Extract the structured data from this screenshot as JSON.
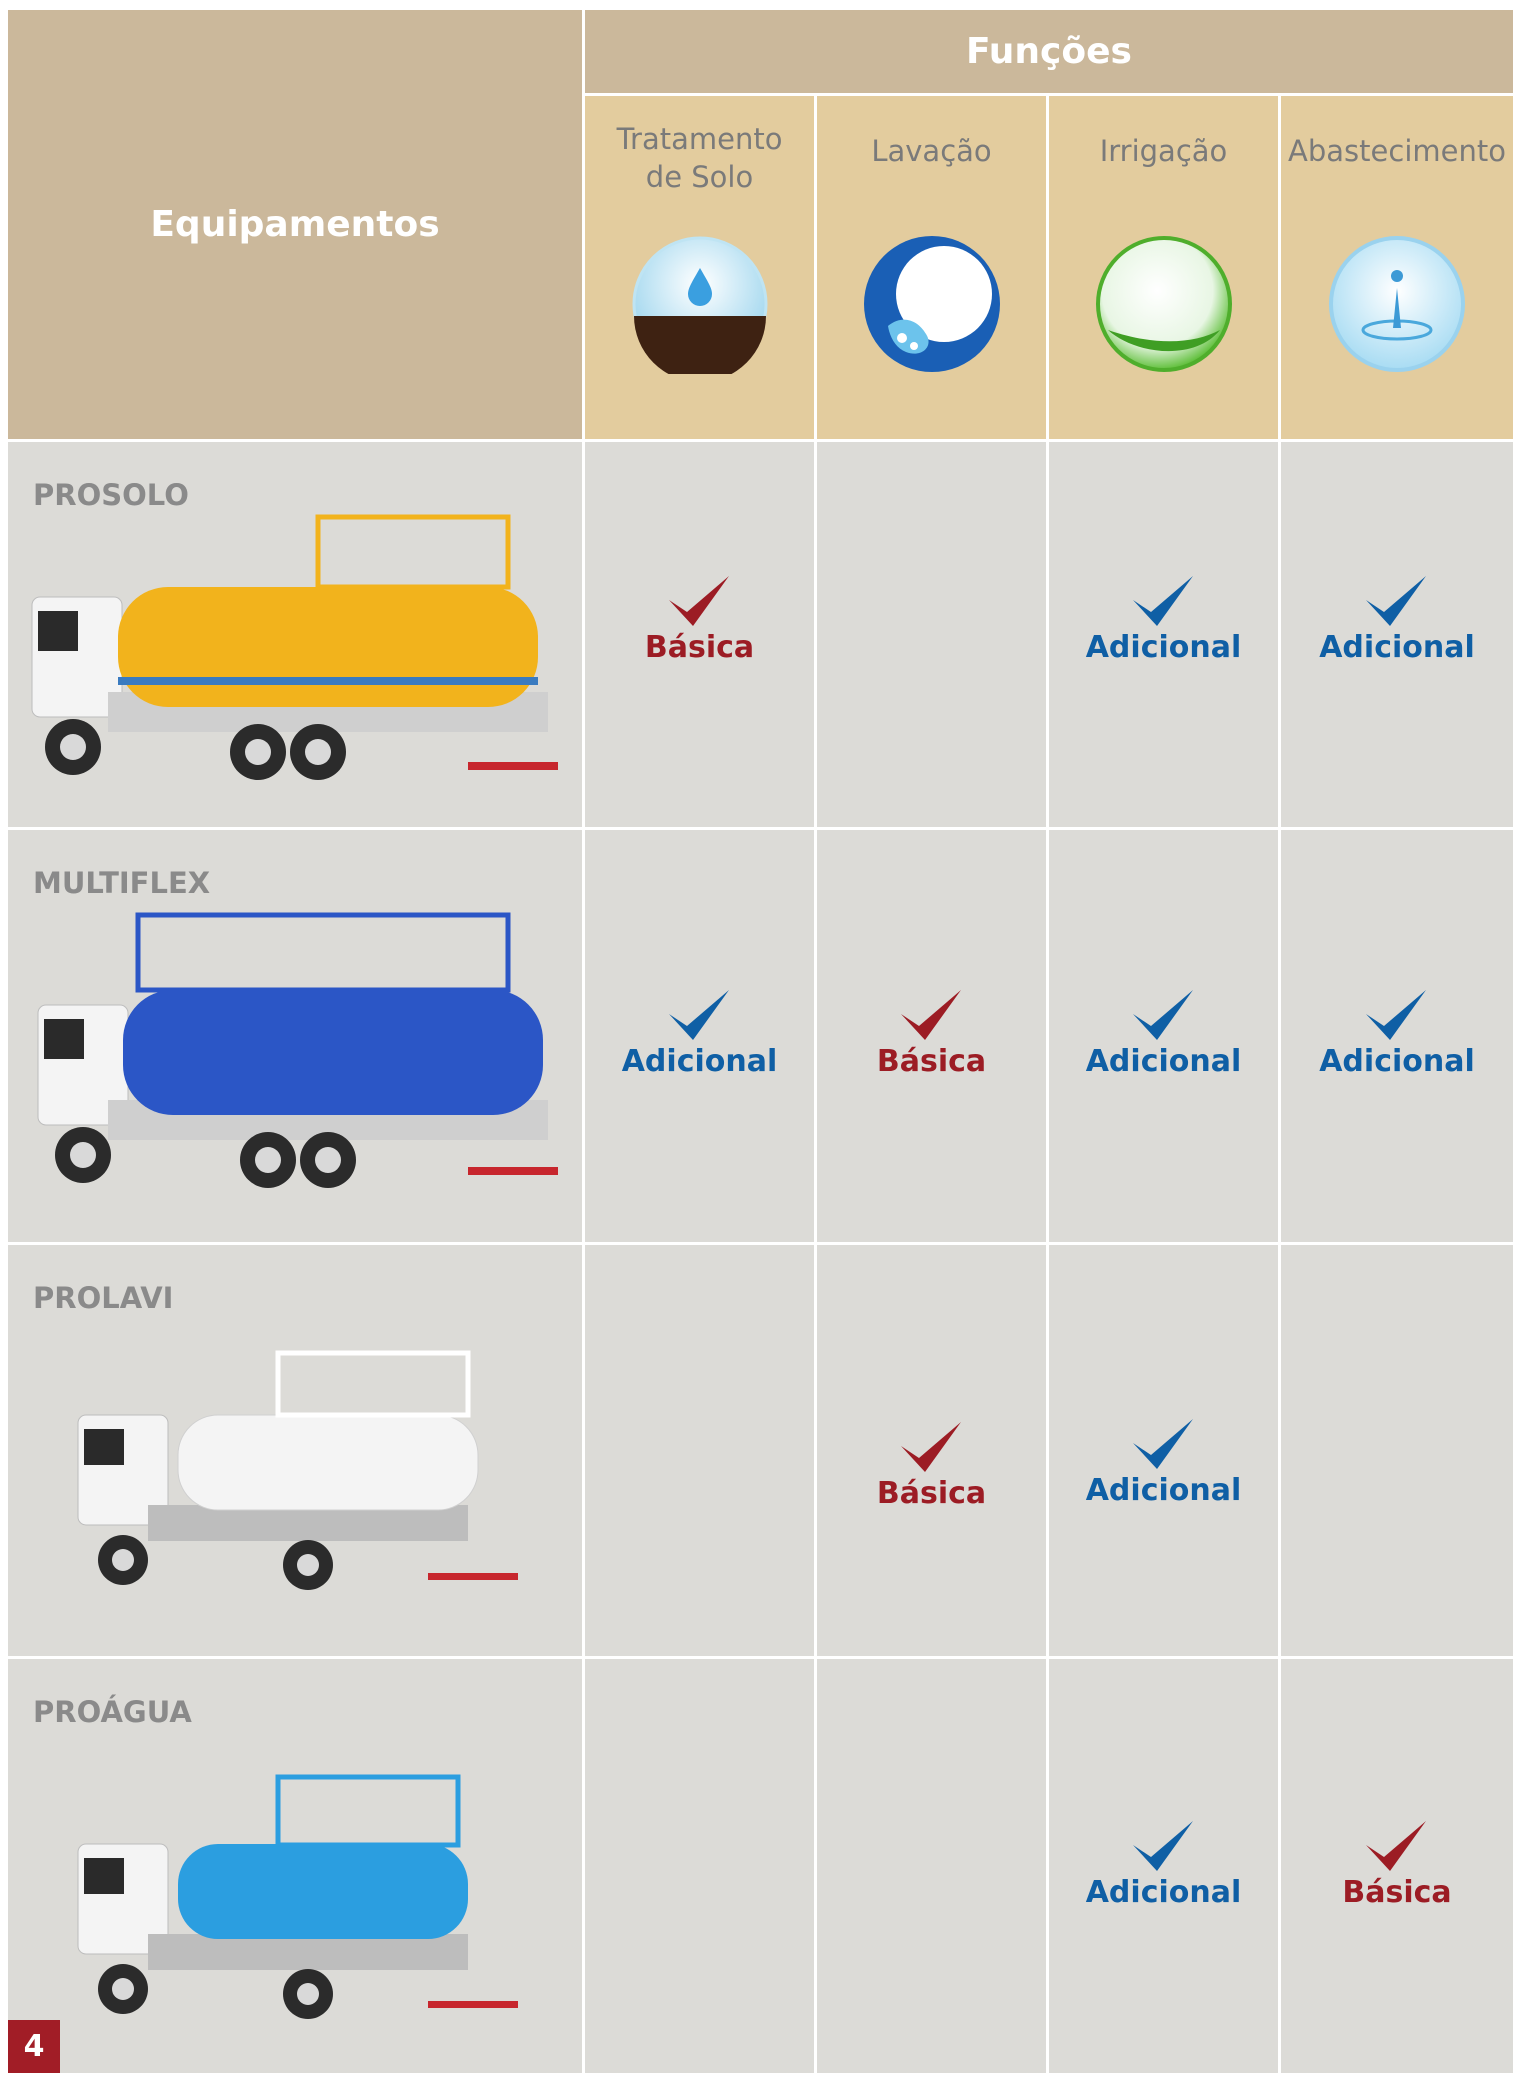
{
  "header": {
    "equipment_label": "Equipamentos",
    "functions_label": "Funções",
    "columns": [
      {
        "label": "Tratamento\nde Solo",
        "icon": "soil-water-drop-icon"
      },
      {
        "label": "Lavação",
        "icon": "wash-wave-icon"
      },
      {
        "label": "Irrigação",
        "icon": "leaf-bubble-icon"
      },
      {
        "label": "Abastecimento",
        "icon": "water-splash-icon"
      }
    ]
  },
  "rows": [
    {
      "name": "PROSOLO",
      "truck_color": "#f2b31c",
      "cells": [
        {
          "label": "Básica",
          "kind": "basic"
        },
        null,
        {
          "label": "Adicional",
          "kind": "add"
        },
        {
          "label": "Adicional",
          "kind": "add"
        }
      ]
    },
    {
      "name": "MULTIFLEX",
      "truck_color": "#2b56c6",
      "cells": [
        {
          "label": "Adicional",
          "kind": "add"
        },
        {
          "label": "Básica",
          "kind": "basic"
        },
        {
          "label": "Adicional",
          "kind": "add"
        },
        {
          "label": "Adicional",
          "kind": "add"
        }
      ]
    },
    {
      "name": "PROLAVI",
      "truck_color": "#f4f4f4",
      "cells": [
        null,
        {
          "label": "Básica",
          "kind": "basic"
        },
        {
          "label": "Adicional",
          "kind": "add"
        },
        null
      ]
    },
    {
      "name": "PROÁGUA",
      "truck_color": "#2b9ee0",
      "cells": [
        null,
        null,
        {
          "label": "Adicional",
          "kind": "add"
        },
        {
          "label": "Básica",
          "kind": "basic"
        }
      ]
    }
  ],
  "page_number": "4",
  "colors": {
    "basic": "#9c1c24",
    "additional": "#0f5fa5",
    "header": "#cbb89b",
    "subheader": "#e3cc9e",
    "row": "#dcdbd7"
  }
}
